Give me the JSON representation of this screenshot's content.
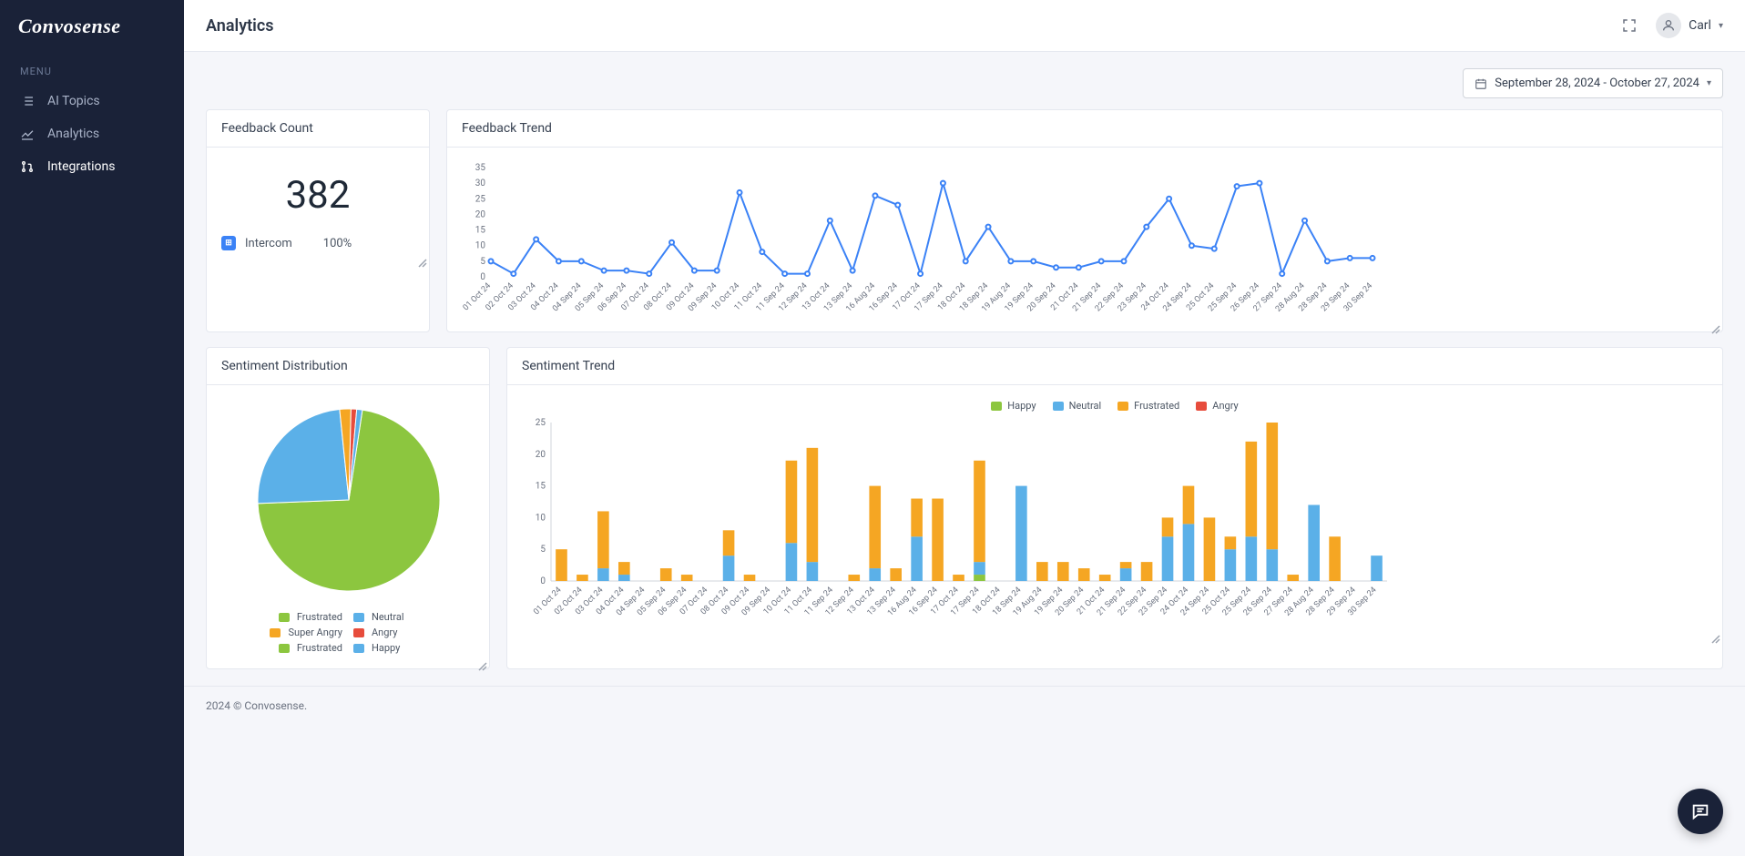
{
  "brand": "Convosense",
  "sidebar": {
    "menu_label": "MENU",
    "items": [
      {
        "label": "AI Topics"
      },
      {
        "label": "Analytics"
      },
      {
        "label": "Integrations"
      }
    ]
  },
  "header": {
    "title": "Analytics",
    "user_name": "Carl"
  },
  "date_range": {
    "label": "September 28, 2024 - October 27, 2024"
  },
  "feedback_count": {
    "title": "Feedback Count",
    "value": "382",
    "source_name": "Intercom",
    "source_pct": "100%"
  },
  "feedback_trend": {
    "title": "Feedback Trend"
  },
  "sentiment_dist": {
    "title": "Sentiment Distribution",
    "legend": [
      {
        "label": "Frustrated",
        "color": "#8cc63f"
      },
      {
        "label": "Neutral",
        "color": "#5bb0e8"
      },
      {
        "label": "Super Angry",
        "color": "#f5a623"
      },
      {
        "label": "Angry",
        "color": "#e74c3c"
      },
      {
        "label": "Frustrated",
        "color": "#8cc63f"
      },
      {
        "label": "Happy",
        "color": "#5bb0e8"
      }
    ]
  },
  "sentiment_trend": {
    "title": "Sentiment Trend",
    "legend": [
      {
        "label": "Happy",
        "color": "#8cc63f"
      },
      {
        "label": "Neutral",
        "color": "#5bb0e8"
      },
      {
        "label": "Frustrated",
        "color": "#f5a623"
      },
      {
        "label": "Angry",
        "color": "#e74c3c"
      }
    ]
  },
  "footer": {
    "text": "2024 © Convosense."
  },
  "colors": {
    "green": "#8cc63f",
    "blue": "#5bb0e8",
    "orange": "#f5a623",
    "red": "#e74c3c",
    "line": "#3b82f6"
  },
  "chart_data": [
    {
      "type": "line",
      "title": "Feedback Trend",
      "ylim": [
        0,
        35
      ],
      "yticks": [
        0,
        5,
        10,
        15,
        20,
        25,
        30,
        35
      ],
      "categories": [
        "01 Oct 24",
        "02 Oct 24",
        "03 Oct 24",
        "04 Oct 24",
        "04 Sep 24",
        "05 Sep 24",
        "06 Sep 24",
        "07 Oct 24",
        "08 Oct 24",
        "09 Oct 24",
        "09 Sep 24",
        "10 Oct 24",
        "11 Oct 24",
        "11 Sep 24",
        "12 Sep 24",
        "13 Oct 24",
        "13 Sep 24",
        "16 Aug 24",
        "16 Sep 24",
        "17 Oct 24",
        "17 Sep 24",
        "18 Oct 24",
        "18 Sep 24",
        "19 Aug 24",
        "19 Sep 24",
        "20 Sep 24",
        "21 Oct 24",
        "21 Sep 24",
        "22 Sep 24",
        "23 Sep 24",
        "24 Oct 24",
        "24 Sep 24",
        "25 Oct 24",
        "25 Sep 24",
        "26 Sep 24",
        "27 Sep 24",
        "28 Aug 24",
        "28 Sep 24",
        "29 Sep 24",
        "30 Sep 24"
      ],
      "values": [
        5,
        1,
        12,
        5,
        5,
        2,
        2,
        1,
        11,
        2,
        2,
        27,
        8,
        1,
        1,
        18,
        2,
        26,
        23,
        1,
        30,
        5,
        16,
        5,
        5,
        3,
        3,
        5,
        5,
        16,
        25,
        10,
        9,
        29,
        30,
        1,
        18,
        5,
        6,
        6
      ]
    },
    {
      "type": "pie",
      "title": "Sentiment Distribution",
      "slices": [
        {
          "label": "Frustrated",
          "value": 72,
          "color": "#8cc63f"
        },
        {
          "label": "Neutral",
          "value": 24,
          "color": "#5bb0e8"
        },
        {
          "label": "Super Angry",
          "value": 2,
          "color": "#f5a623"
        },
        {
          "label": "Angry",
          "value": 1,
          "color": "#e74c3c"
        },
        {
          "label": "Happy",
          "value": 1,
          "color": "#5bb0e8"
        }
      ]
    },
    {
      "type": "bar",
      "title": "Sentiment Trend",
      "stacked": true,
      "ylim": [
        0,
        25
      ],
      "yticks": [
        0,
        5,
        10,
        15,
        20,
        25
      ],
      "categories": [
        "01 Oct 24",
        "02 Oct 24",
        "03 Oct 24",
        "04 Oct 24",
        "04 Sep 24",
        "05 Sep 24",
        "06 Sep 24",
        "07 Oct 24",
        "08 Oct 24",
        "09 Oct 24",
        "09 Sep 24",
        "10 Oct 24",
        "11 Oct 24",
        "11 Sep 24",
        "12 Sep 24",
        "13 Oct 24",
        "13 Sep 24",
        "16 Aug 24",
        "16 Sep 24",
        "17 Oct 24",
        "17 Sep 24",
        "18 Oct 24",
        "18 Sep 24",
        "19 Aug 24",
        "19 Sep 24",
        "20 Sep 24",
        "21 Oct 24",
        "21 Sep 24",
        "22 Sep 24",
        "23 Sep 24",
        "24 Oct 24",
        "24 Sep 24",
        "25 Oct 24",
        "25 Sep 24",
        "26 Sep 24",
        "27 Sep 24",
        "28 Aug 24",
        "28 Sep 24",
        "29 Sep 24",
        "30 Sep 24"
      ],
      "series": [
        {
          "name": "Happy",
          "color": "#8cc63f",
          "values": [
            0,
            0,
            0,
            0,
            0,
            0,
            0,
            0,
            0,
            0,
            0,
            0,
            0,
            0,
            0,
            0,
            0,
            0,
            0,
            0,
            1,
            0,
            0,
            0,
            0,
            0,
            0,
            0,
            0,
            0,
            0,
            0,
            0,
            0,
            0,
            0,
            0,
            0,
            0,
            0
          ]
        },
        {
          "name": "Neutral",
          "color": "#5bb0e8",
          "values": [
            0,
            0,
            2,
            1,
            0,
            0,
            0,
            0,
            4,
            0,
            0,
            6,
            3,
            0,
            0,
            2,
            0,
            7,
            0,
            0,
            2,
            0,
            15,
            0,
            0,
            0,
            0,
            2,
            0,
            7,
            9,
            0,
            5,
            7,
            5,
            0,
            12,
            0,
            0,
            4
          ]
        },
        {
          "name": "Frustrated",
          "color": "#f5a623",
          "values": [
            5,
            1,
            9,
            2,
            0,
            2,
            1,
            0,
            4,
            1,
            0,
            13,
            18,
            0,
            1,
            13,
            2,
            6,
            13,
            1,
            16,
            0,
            0,
            3,
            3,
            2,
            1,
            1,
            3,
            3,
            6,
            10,
            2,
            15,
            20,
            1,
            0,
            7,
            0,
            0
          ]
        },
        {
          "name": "Angry",
          "color": "#e74c3c",
          "values": [
            0,
            0,
            0,
            0,
            0,
            0,
            0,
            0,
            0,
            0,
            0,
            0,
            0,
            0,
            0,
            0,
            0,
            0,
            0,
            0,
            0,
            0,
            0,
            0,
            0,
            0,
            0,
            0,
            0,
            0,
            0,
            0,
            0,
            0,
            0,
            0,
            0,
            0,
            0,
            0
          ]
        }
      ]
    }
  ]
}
